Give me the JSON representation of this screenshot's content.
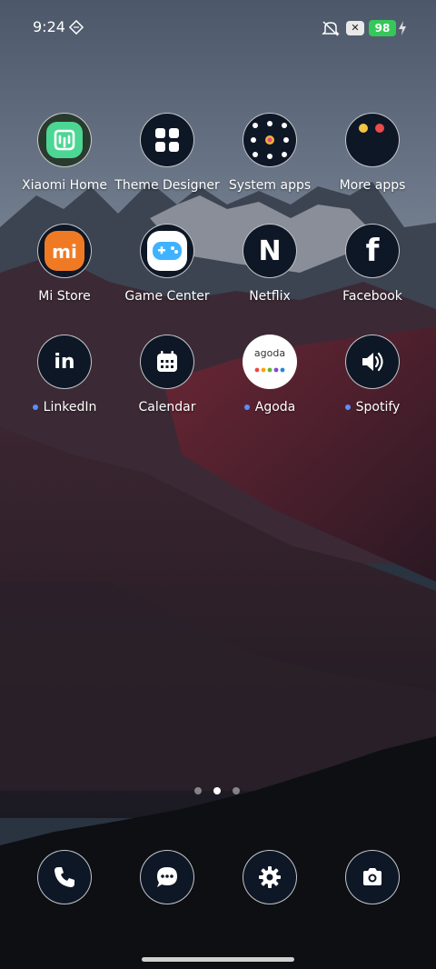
{
  "status_bar": {
    "time": "9:24",
    "battery_level": "98",
    "x_badge": "✕",
    "battery_color": "#35c759",
    "icons": [
      "nfc-icon",
      "mute-icon",
      "x-box-icon",
      "battery-icon",
      "charging-icon"
    ]
  },
  "apps": [
    {
      "label": "Xiaomi Home",
      "icon": "xiaomi-home-icon",
      "notification_dot": false
    },
    {
      "label": "Theme Designer",
      "icon": "theme-designer-icon",
      "notification_dot": false
    },
    {
      "label": "System apps",
      "icon": "system-apps-folder-icon",
      "notification_dot": false
    },
    {
      "label": "More apps",
      "icon": "more-apps-folder-icon",
      "notification_dot": false
    },
    {
      "label": "Mi Store",
      "icon": "mi-store-icon",
      "notification_dot": false
    },
    {
      "label": "Game Center",
      "icon": "game-center-icon",
      "notification_dot": false
    },
    {
      "label": "Netflix",
      "icon": "netflix-icon",
      "notification_dot": false
    },
    {
      "label": "Facebook",
      "icon": "facebook-icon",
      "notification_dot": false
    },
    {
      "label": "LinkedIn",
      "icon": "linkedin-icon",
      "notification_dot": true
    },
    {
      "label": "Calendar",
      "icon": "calendar-icon",
      "notification_dot": false
    },
    {
      "label": "Agoda",
      "icon": "agoda-icon",
      "notification_dot": true
    },
    {
      "label": "Spotify",
      "icon": "spotify-icon",
      "notification_dot": true
    }
  ],
  "agoda_wordmark": "agoda",
  "mi_logo": "mi",
  "linkedin_logo": "in",
  "netflix_logo": "N",
  "facebook_logo": "f",
  "pager": {
    "pages": 3,
    "active": 2
  },
  "dock": [
    "phone-icon",
    "messages-icon",
    "settings-icon",
    "camera-icon"
  ],
  "colors": {
    "accent_dot": "#5b8cff",
    "icon_bg": "#0e1726"
  }
}
